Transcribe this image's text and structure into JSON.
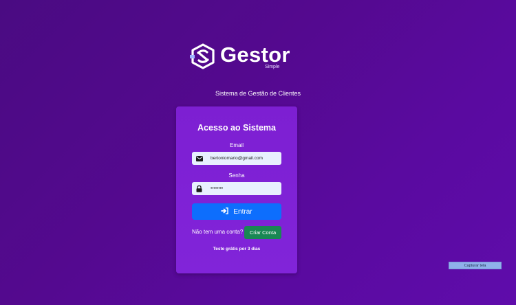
{
  "brand": {
    "name": "Gestor",
    "sub": "Simple"
  },
  "tagline": "Sistema de Gestão de Clientes",
  "login": {
    "title": "Acesso ao Sistema",
    "email_label": "Email",
    "email_value": "bertoniomario@gmail.com",
    "password_label": "Senha",
    "password_value": "••••••••",
    "submit_label": "Entrar",
    "signup_question": "Não tem uma conta?",
    "signup_button": "Criar Conta",
    "trial_text": "Teste grátis por 3 dias"
  },
  "capture_button": "Capturar tela",
  "icons": {
    "logo": "gestor-logo-icon",
    "email": "envelope-icon",
    "password": "lock-icon",
    "submit": "sign-in-icon"
  },
  "colors": {
    "background": "#54098f",
    "card": "#7d1fd2",
    "primary_button": "#0d6efd",
    "success_button": "#198754",
    "input_bg": "#e8f0fe"
  }
}
